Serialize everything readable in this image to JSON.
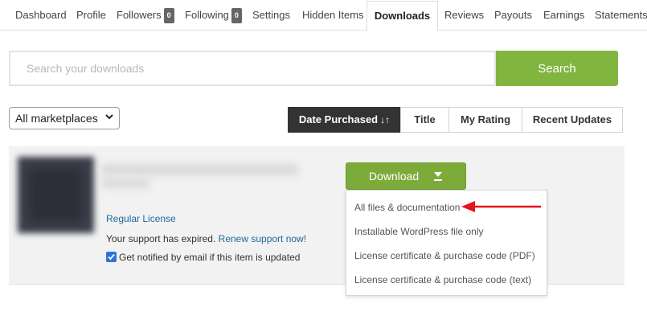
{
  "nav": {
    "tabs": [
      {
        "label": "Dashboard"
      },
      {
        "label": "Profile"
      },
      {
        "label": "Followers",
        "badge": "0"
      },
      {
        "label": "Following",
        "badge": "0"
      },
      {
        "label": "Settings"
      },
      {
        "label": "Hidden Items"
      },
      {
        "label": "Downloads",
        "active": true
      },
      {
        "label": "Reviews"
      },
      {
        "label": "Payouts"
      },
      {
        "label": "Earnings"
      },
      {
        "label": "Statements"
      }
    ]
  },
  "search": {
    "placeholder": "Search your downloads",
    "button_label": "Search"
  },
  "filters": {
    "marketplace_selected": "All marketplaces",
    "sort_buttons": [
      {
        "label": "Date Purchased",
        "active": true,
        "icon": "sort-arrows-icon"
      },
      {
        "label": "Title"
      },
      {
        "label": "My Rating"
      },
      {
        "label": "Recent Updates"
      }
    ]
  },
  "item": {
    "license_label": "Regular License",
    "support_text": "Your support has expired.",
    "support_link": "Renew support now!",
    "notify_label": "Get notified by email if this item is updated",
    "notify_checked": true
  },
  "download": {
    "button_label": "Download",
    "menu": [
      {
        "label": "All files & documentation"
      },
      {
        "label": "Installable WordPress file only"
      },
      {
        "label": "License certificate & purchase code (PDF)"
      },
      {
        "label": "License certificate & purchase code (text)"
      }
    ]
  },
  "colors": {
    "accent_green": "#82b440",
    "active_sort_bg": "#333333",
    "link_blue": "#1a6a9d",
    "annotation_red": "#e8121f"
  }
}
